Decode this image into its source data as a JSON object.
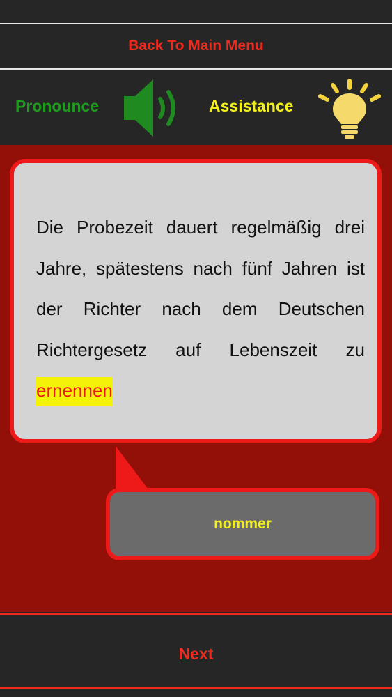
{
  "header": {
    "back_label": "Back To Main Menu"
  },
  "tools": {
    "pronounce_label": "Pronounce",
    "assistance_label": "Assistance",
    "pronounce_icon": "speaker-icon",
    "assistance_icon": "lightbulb-icon"
  },
  "question": {
    "sentence_before": "Die Probezeit dauert regelmäßig drei Jahre, spätestens nach fünf Jahren ist der Richter nach dem Deutschen Richtergesetz auf Lebenszeit zu ",
    "highlighted_word": "ernennen"
  },
  "answer": {
    "label": "nommer"
  },
  "footer": {
    "next_label": "Next"
  },
  "colors": {
    "accent_red": "#ee2a1f",
    "pronounce_green": "#1f9a1f",
    "assist_yellow": "#f2ef1a",
    "content_bg": "#921007"
  }
}
